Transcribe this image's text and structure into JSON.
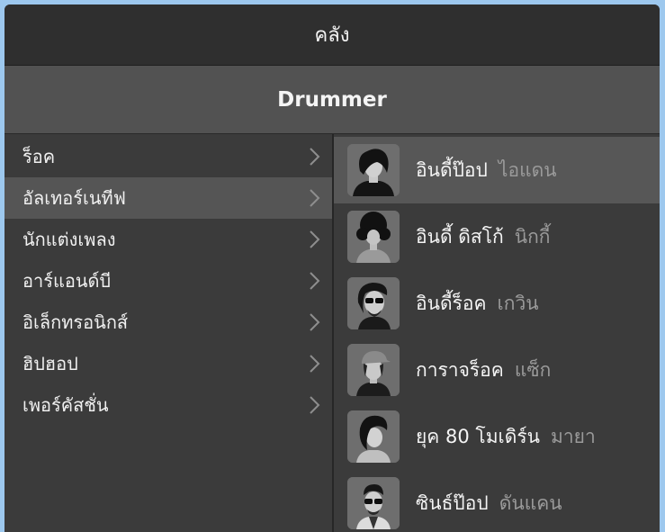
{
  "header": {
    "title": "คลัง",
    "subtitle": "Drummer"
  },
  "categories": [
    {
      "label": "ร็อค",
      "selected": false
    },
    {
      "label": "อัลเทอร์เนทีฟ",
      "selected": true
    },
    {
      "label": "นักแต่งเพลง",
      "selected": false
    },
    {
      "label": "อาร์แอนด์บี",
      "selected": false
    },
    {
      "label": "อิเล็กทรอนิกส์",
      "selected": false
    },
    {
      "label": "ฮิปฮอป",
      "selected": false
    },
    {
      "label": "เพอร์คัสชั่น",
      "selected": false
    }
  ],
  "drummers": [
    {
      "style": "อินดี้ป๊อป",
      "name": "ไอแดน",
      "selected": true
    },
    {
      "style": "อินดี้ ดิสโก้",
      "name": "นิกกี้",
      "selected": false
    },
    {
      "style": "อินดี้ร็อค",
      "name": "เกวิน",
      "selected": false
    },
    {
      "style": "การาจร็อค",
      "name": "แซ็ก",
      "selected": false
    },
    {
      "style": "ยุค 80 โมเดิร์น",
      "name": "มายา",
      "selected": false
    },
    {
      "style": "ซินธ์ป๊อป",
      "name": "ดันแคน",
      "selected": false
    }
  ],
  "colors": {
    "background": "#9dc8ee",
    "titlebar": "#2f2f2f",
    "subbar": "#525252",
    "panel": "#3b3b3b",
    "selected_row": "#555555",
    "secondary_text": "#9a9a9a"
  }
}
